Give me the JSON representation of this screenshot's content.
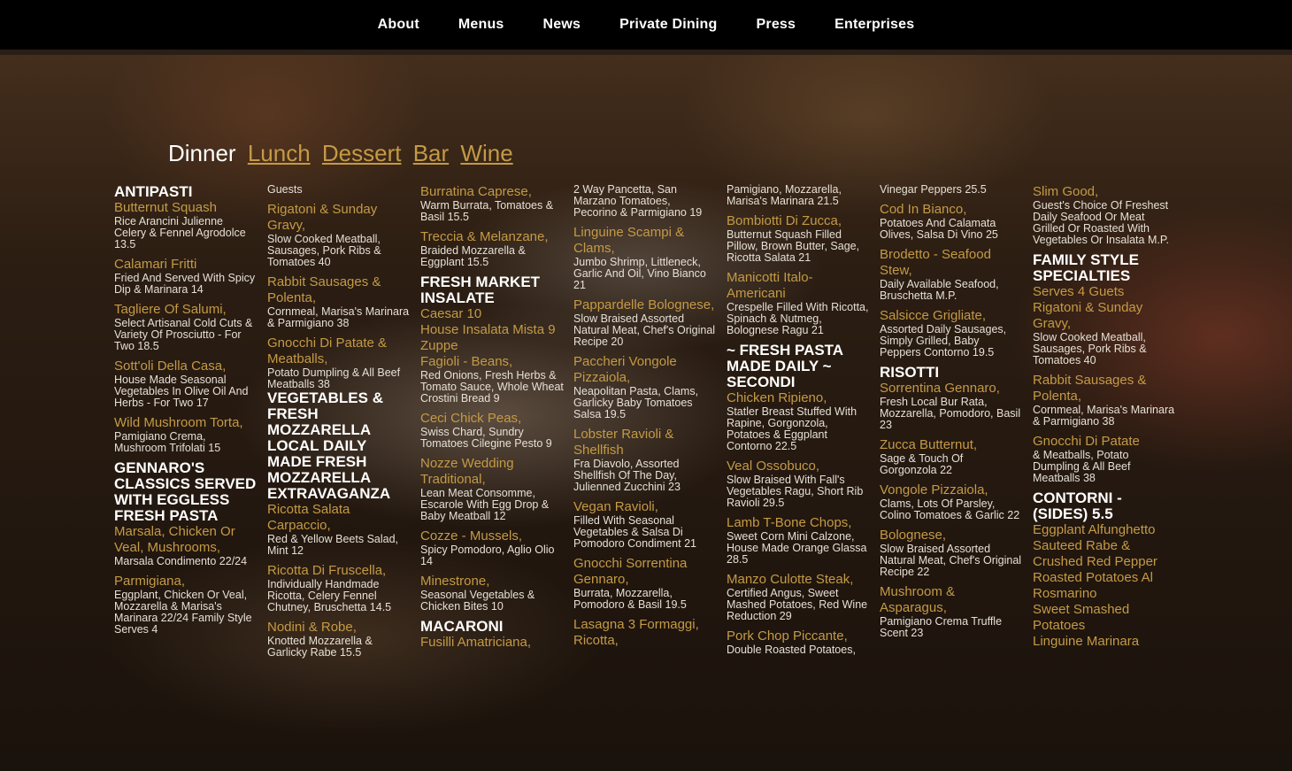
{
  "nav": [
    "About",
    "Menus",
    "News",
    "Private Dining",
    "Press",
    "Enterprises"
  ],
  "tabs": {
    "active": "Dinner",
    "links": [
      "Lunch",
      "Dessert",
      "Bar",
      "Wine"
    ]
  },
  "columns": [
    [
      {
        "t": "sec",
        "text": "ANTIPASTI"
      },
      {
        "t": "it",
        "text": "Butternut Squash"
      },
      {
        "t": "ds",
        "text": "Rice Arancini Julienne Celery & Fennel Agrodolce 13.5"
      },
      {
        "t": "it",
        "text": "Calamari Fritti",
        "m": 1
      },
      {
        "t": "ds",
        "text": "Fried And Served With Spicy Dip & Marinara 14"
      },
      {
        "t": "it",
        "text": "Tagliere Of Salumi,",
        "m": 1
      },
      {
        "t": "ds",
        "text": "Select Artisanal Cold Cuts & Variety Of Prosciutto - For Two 18.5"
      },
      {
        "t": "it",
        "text": "Sott'oli Della Casa,",
        "m": 1
      },
      {
        "t": "ds",
        "text": "House Made Seasonal Vegetables In Olive Oil And Herbs - For Two 17"
      },
      {
        "t": "it",
        "text": "Wild Mushroom Torta,",
        "m": 1
      },
      {
        "t": "ds",
        "text": "Pamigiano Crema, Mushroom Trifolati 15"
      },
      {
        "t": "sec",
        "text": "GENNARO'S CLASSICS SERVED WITH EGGLESS FRESH PASTA",
        "m": 1
      },
      {
        "t": "it",
        "text": "Marsala, Chicken Or Veal, Mushrooms,"
      },
      {
        "t": "ds",
        "text": "Marsala Condimento 22/24"
      },
      {
        "t": "it",
        "text": "Parmigiana,",
        "m": 1
      },
      {
        "t": "ds",
        "text": "Eggplant, Chicken Or Veal, Mozzarella & Marisa's Marinara 22/24 Family Style Serves 4"
      }
    ],
    [
      {
        "t": "ds",
        "text": "Guests"
      },
      {
        "t": "it",
        "text": "Rigatoni & Sunday Gravy,",
        "m": 1
      },
      {
        "t": "ds",
        "text": "Slow Cooked Meatball, Sausages, Pork Ribs & Tomatoes 40"
      },
      {
        "t": "it",
        "text": "Rabbit Sausages & Polenta,",
        "m": 1
      },
      {
        "t": "ds",
        "text": "Cornmeal, Marisa's Marinara & Parmigiano 38"
      },
      {
        "t": "it",
        "text": "Gnocchi Di Patate & Meatballs,",
        "m": 1
      },
      {
        "t": "ds",
        "text": "Potato Dumpling & All Beef Meatballs 38"
      },
      {
        "t": "sec",
        "text": "VEGETABLES & FRESH MOZZARELLA LOCAL DAILY MADE FRESH MOZZARELLA EXTRAVAGANZA"
      },
      {
        "t": "it",
        "text": "Ricotta Salata Carpaccio,"
      },
      {
        "t": "ds",
        "text": "Red & Yellow Beets Salad, Mint 12"
      },
      {
        "t": "it",
        "text": "Ricotta Di Fruscella,",
        "m": 1
      },
      {
        "t": "ds",
        "text": "Individually Handmade Ricotta, Celery Fennel Chutney, Bruschetta 14.5"
      },
      {
        "t": "it",
        "text": "Nodini & Robe,",
        "m": 1
      },
      {
        "t": "ds",
        "text": "Knotted Mozzarella & Garlicky Rabe 15.5"
      }
    ],
    [
      {
        "t": "it",
        "text": "Burratina Caprese,"
      },
      {
        "t": "ds",
        "text": "Warm Burrata, Tomatoes & Basil 15.5"
      },
      {
        "t": "it",
        "text": "Treccia & Melanzane,",
        "m": 1
      },
      {
        "t": "ds",
        "text": "Braided Mozzarella & Eggplant 15.5"
      },
      {
        "t": "sec",
        "text": "FRESH MARKET INSALATE",
        "m": 1
      },
      {
        "t": "it",
        "text": "Caesar 10"
      },
      {
        "t": "it",
        "text": "House Insalata Mista 9"
      },
      {
        "t": "it",
        "text": "Zuppe"
      },
      {
        "t": "it",
        "text": "Fagioli - Beans,"
      },
      {
        "t": "ds",
        "text": "Red Onions, Fresh Herbs & Tomato Sauce, Whole Wheat Crostini Bread 9"
      },
      {
        "t": "it",
        "text": "Ceci Chick Peas,",
        "m": 1
      },
      {
        "t": "ds",
        "text": "Swiss Chard, Sundry Tomatoes Cilegine Pesto 9"
      },
      {
        "t": "it",
        "text": "Nozze Wedding Traditional,",
        "m": 1
      },
      {
        "t": "ds",
        "text": "Lean Meat Consomme, Escarole With Egg Drop & Baby Meatball 12"
      },
      {
        "t": "it",
        "text": "Cozze - Mussels,",
        "m": 1
      },
      {
        "t": "ds",
        "text": "Spicy Pomodoro, Aglio Olio 14"
      },
      {
        "t": "it",
        "text": "Minestrone,",
        "m": 1
      },
      {
        "t": "ds",
        "text": "Seasonal Vegetables & Chicken Bites 10"
      },
      {
        "t": "sec",
        "text": "MACARONI",
        "m": 1
      },
      {
        "t": "it",
        "text": "Fusilli Amatriciana,"
      }
    ],
    [
      {
        "t": "ds",
        "text": "2 Way Pancetta, San Marzano Tomatoes, Pecorino & Parmigiano 19"
      },
      {
        "t": "it",
        "text": "Linguine Scampi & Clams,",
        "m": 1
      },
      {
        "t": "ds",
        "text": "Jumbo Shrimp, Littleneck, Garlic And Oil, Vino Bianco 21"
      },
      {
        "t": "it",
        "text": "Pappardelle Bolognese,",
        "m": 1
      },
      {
        "t": "ds",
        "text": "Slow Braised Assorted Natural Meat, Chef's Original Recipe 20"
      },
      {
        "t": "it",
        "text": "Paccheri Vongole Pizzaiola,",
        "m": 1
      },
      {
        "t": "ds",
        "text": "Neapolitan Pasta, Clams, Garlicky Baby Tomatoes Salsa 19.5"
      },
      {
        "t": "it",
        "text": "Lobster Ravioli & Shellfish",
        "m": 1
      },
      {
        "t": "ds",
        "text": "Fra Diavolo, Assorted Shellfish Of The Day, Julienned Zucchini 23"
      },
      {
        "t": "it",
        "text": "Vegan Ravioli,",
        "m": 1
      },
      {
        "t": "ds",
        "text": "Filled With Seasonal Vegetables & Salsa Di Pomodoro Condiment 21"
      },
      {
        "t": "it",
        "text": "Gnocchi Sorrentina Gennaro,",
        "m": 1
      },
      {
        "t": "ds",
        "text": "Burrata, Mozzarella, Pomodoro & Basil 19.5"
      },
      {
        "t": "it",
        "text": "Lasagna 3 Formaggi, Ricotta,",
        "m": 1
      }
    ],
    [
      {
        "t": "ds",
        "text": "Pamigiano, Mozzarella, Marisa's Marinara 21.5"
      },
      {
        "t": "it",
        "text": "Bombiotti Di Zucca,",
        "m": 1
      },
      {
        "t": "ds",
        "text": "Butternut Squash Filled Pillow, Brown Butter, Sage, Ricotta Salata 21"
      },
      {
        "t": "it",
        "text": "Manicotti Italo-Americani",
        "m": 1
      },
      {
        "t": "ds",
        "text": "Crespelle Filled With Ricotta, Spinach & Nutmeg, Bolognese Ragu 21"
      },
      {
        "t": "sec",
        "text": "~ FRESH PASTA MADE DAILY ~ SECONDI",
        "m": 1
      },
      {
        "t": "it",
        "text": "Chicken Ripieno,"
      },
      {
        "t": "ds",
        "text": "Statler Breast Stuffed With Rapine, Gorgonzola, Potatoes & Eggplant Contorno 22.5"
      },
      {
        "t": "it",
        "text": "Veal Ossobuco,",
        "m": 1
      },
      {
        "t": "ds",
        "text": "Slow Braised With Fall's Vegetables Ragu, Short Rib Ravioli 29.5"
      },
      {
        "t": "it",
        "text": "Lamb T-Bone Chops,",
        "m": 1
      },
      {
        "t": "ds",
        "text": "Sweet Corn Mini Calzone, House Made Orange Glassa 28.5"
      },
      {
        "t": "it",
        "text": "Manzo Culotte Steak,",
        "m": 1
      },
      {
        "t": "ds",
        "text": "Certified Angus, Sweet Mashed Potatoes, Red Wine Reduction 29"
      },
      {
        "t": "it",
        "text": "Pork Chop Piccante,",
        "m": 1
      },
      {
        "t": "ds",
        "text": "Double Roasted Potatoes,"
      }
    ],
    [
      {
        "t": "ds",
        "text": "Vinegar Peppers 25.5"
      },
      {
        "t": "it",
        "text": "Cod In Bianco,",
        "m": 1
      },
      {
        "t": "ds",
        "text": "Potatoes And Calamata Olives, Salsa Di Vino 25"
      },
      {
        "t": "it",
        "text": "Brodetto - Seafood Stew,",
        "m": 1
      },
      {
        "t": "ds",
        "text": "Daily Available Seafood, Bruschetta M.P."
      },
      {
        "t": "it",
        "text": "Salsicce Grigliate,",
        "m": 1
      },
      {
        "t": "ds",
        "text": "Assorted Daily Sausages, Simply Grilled, Baby Peppers Contorno 19.5"
      },
      {
        "t": "sec",
        "text": "RISOTTI",
        "m": 1
      },
      {
        "t": "it",
        "text": "Sorrentina Gennaro,"
      },
      {
        "t": "ds",
        "text": "Fresh Local Bur Rata, Mozzarella, Pomodoro, Basil 23"
      },
      {
        "t": "it",
        "text": "Zucca Butternut,",
        "m": 1
      },
      {
        "t": "ds",
        "text": "Sage & Touch Of Gorgonzola 22"
      },
      {
        "t": "it",
        "text": "Vongole Pizzaiola,",
        "m": 1
      },
      {
        "t": "ds",
        "text": "Clams, Lots Of Parsley, Colino Tomatoes & Garlic 22"
      },
      {
        "t": "it",
        "text": "Bolognese,",
        "m": 1
      },
      {
        "t": "ds",
        "text": "Slow Braised Assorted Natural Meat, Chef's Original Recipe 22"
      },
      {
        "t": "it",
        "text": "Mushroom & Asparagus,",
        "m": 1
      },
      {
        "t": "ds",
        "text": "Pamigiano Crema Truffle Scent 23"
      }
    ],
    [
      {
        "t": "it",
        "text": "Slim Good,"
      },
      {
        "t": "ds",
        "text": "Guest's Choice Of Freshest Daily Seafood Or Meat Grilled Or Roasted With Vegetables Or Insalata M.P."
      },
      {
        "t": "sec",
        "text": "FAMILY STYLE SPECIALTIES",
        "m": 1
      },
      {
        "t": "it",
        "text": "Serves 4 Guets"
      },
      {
        "t": "it",
        "text": "Rigatoni & Sunday Gravy,"
      },
      {
        "t": "ds",
        "text": "Slow Cooked Meatball, Sausages, Pork Ribs & Tomatoes 40"
      },
      {
        "t": "it",
        "text": "Rabbit Sausages & Polenta,",
        "m": 1
      },
      {
        "t": "ds",
        "text": "Cornmeal, Marisa's Marinara & Parmigiano 38"
      },
      {
        "t": "it",
        "text": "Gnocchi Di Patate",
        "m": 1
      },
      {
        "t": "ds",
        "text": "& Meatballs, Potato Dumpling & All Beef Meatballs 38"
      },
      {
        "t": "sec",
        "text": "CONTORNI - (SIDES) 5.5",
        "m": 1
      },
      {
        "t": "it",
        "text": "Eggplant Alfunghetto"
      },
      {
        "t": "it",
        "text": "Sauteed Rabe & Crushed Red Pepper"
      },
      {
        "t": "it",
        "text": "Roasted Potatoes Al Rosmarino"
      },
      {
        "t": "it",
        "text": "Sweet Smashed Potatoes"
      },
      {
        "t": "it",
        "text": "Linguine Marinara"
      }
    ]
  ]
}
